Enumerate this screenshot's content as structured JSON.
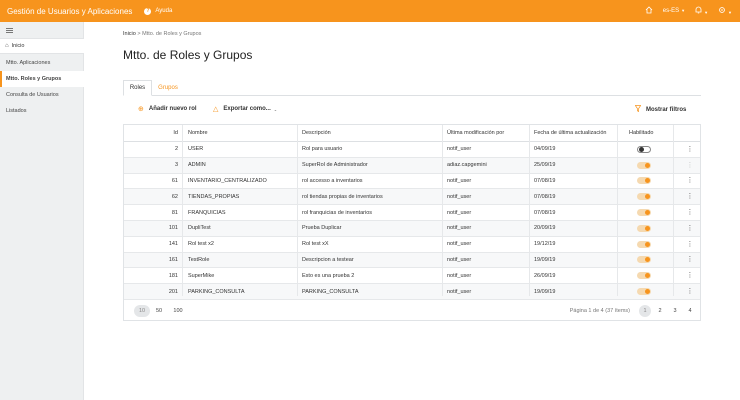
{
  "header": {
    "app_title": "Gestión de Usuarios y Aplicaciones",
    "help_label": "Ayuda",
    "language": "es-ES",
    "accent_color": "#f7941d"
  },
  "sidebar": {
    "home": "Inicio",
    "items": [
      {
        "label": "Mtto. Aplicaciones",
        "active": false
      },
      {
        "label": "Mtto. Roles y Grupos",
        "active": true
      },
      {
        "label": "Consulta de Usuarios",
        "active": false
      },
      {
        "label": "Listados",
        "active": false
      }
    ]
  },
  "breadcrumb": {
    "home": "Inicio",
    "separator": ">",
    "current": "Mtto. de Roles y Grupos"
  },
  "page_title": "Mtto. de Roles y Grupos",
  "tabs": [
    "Roles",
    "Grupos"
  ],
  "toolbar": {
    "add": "Añadir nuevo rol",
    "export": "Exportar como...",
    "filters": "Mostrar filtros"
  },
  "table": {
    "columns": [
      "Id",
      "Nombre",
      "Descripción",
      "Última modificación por",
      "Fecha de última actualización",
      "Habilitado"
    ],
    "rows": [
      {
        "id": "2",
        "nombre": "USER",
        "descripcion": "Rol para usuario",
        "modificado": "notif_user",
        "fecha": "04/09/19",
        "habilitado": false
      },
      {
        "id": "3",
        "nombre": "ADMIN",
        "descripcion": "SuperRol de Administrador",
        "modificado": "adiaz.capgemini",
        "fecha": "25/09/19",
        "habilitado": true
      },
      {
        "id": "61",
        "nombre": "INVENTARIO_CENTRALIZADO",
        "descripcion": "rol accesso a inventarios",
        "modificado": "notif_user",
        "fecha": "07/08/19",
        "habilitado": true
      },
      {
        "id": "62",
        "nombre": "TIENDAS_PROPIAS",
        "descripcion": "rol tiendas propias de inventarios",
        "modificado": "notif_user",
        "fecha": "07/08/19",
        "habilitado": true
      },
      {
        "id": "81",
        "nombre": "FRANQUICIAS",
        "descripcion": "rol franquicias de inventarios",
        "modificado": "notif_user",
        "fecha": "07/08/19",
        "habilitado": true
      },
      {
        "id": "101",
        "nombre": "DupliTest",
        "descripcion": "Prueba Duplicar",
        "modificado": "notif_user",
        "fecha": "20/09/19",
        "habilitado": true
      },
      {
        "id": "141",
        "nombre": "Rol test x2",
        "descripcion": "Rol test xX",
        "modificado": "notif_user",
        "fecha": "19/12/19",
        "habilitado": true
      },
      {
        "id": "161",
        "nombre": "TestRole",
        "descripcion": "Descripcion a testear",
        "modificado": "notif_user",
        "fecha": "19/09/19",
        "habilitado": true
      },
      {
        "id": "181",
        "nombre": "SuperMike",
        "descripcion": "Esto es una prueba 2",
        "modificado": "notif_user",
        "fecha": "26/09/19",
        "habilitado": true
      },
      {
        "id": "201",
        "nombre": "PARKING_CONSULTA",
        "descripcion": "PARKING_CONSULTA",
        "modificado": "notif_user",
        "fecha": "19/09/19",
        "habilitado": true
      }
    ]
  },
  "pagination": {
    "page_sizes": [
      "10",
      "50",
      "100"
    ],
    "selected_size": "10",
    "info": "Página 1 de 4 (37 ítems)",
    "pages": [
      "1",
      "2",
      "3",
      "4"
    ],
    "current_page": "1"
  }
}
